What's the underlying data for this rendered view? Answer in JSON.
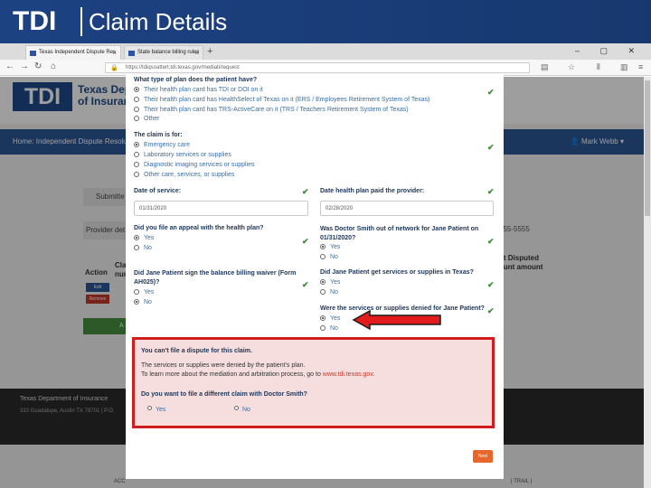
{
  "slide": {
    "logo": "TDI",
    "title": "Claim Details"
  },
  "browser": {
    "tabs": [
      {
        "label": "Texas Independent Dispute Res",
        "close": "×"
      },
      {
        "label": "State balance billing rules",
        "close": "×"
      }
    ],
    "new_tab": "+",
    "window_controls": "– ▢ ✕",
    "url": "https://tdiqsoattert.tdi.texas.gov/mediati/request"
  },
  "background_page": {
    "logo_mark": "TDI",
    "logo_text_1": "Texas Dep",
    "logo_text_2": "of Insuran",
    "nav_left": "Home: Independent Dispute Resolu",
    "nav_right": "Mark Webb ▾",
    "submitted": "Submitte",
    "provider": "Provider det",
    "phone": "555-5555",
    "col_action": "Action",
    "col_claim": "Cla nun",
    "col_right": "nt Disputed ount amount",
    "edit": "Edit",
    "remove": "Remove",
    "green_btn": "A",
    "footer_title": "Texas Department of Insurance",
    "footer_address": "333 Guadalupe, Austin TX 78701 | P.O.",
    "footer_links": "| TRAIL |",
    "footer_acc": "ACC"
  },
  "form": {
    "q_plan_type": "What type of plan does the patient have?",
    "plan_options": [
      "Their health plan card has TDI or DOI on it",
      "Their health plan card has HealthSelect of Texas on it (ERS / Employees Retirement System of Texas)",
      "Their health plan card has TRS-ActiveCare on it (TRS / Teachers Retirement System of Texas)",
      "Other"
    ],
    "q_claim_for": "The claim is for:",
    "claim_options": [
      "Emergency care",
      "Laboratory services or supplies",
      "Diagnostic imaging services or supplies",
      "Other care, services, or supplies"
    ],
    "date_of_service_label": "Date of service:",
    "date_of_service_value": "01/31/2020",
    "date_paid_label": "Date health plan paid the provider:",
    "date_paid_value": "02/28/2020",
    "q_appeal": "Did you file an appeal with the health plan?",
    "q_out_of_network": "Was Doctor Smith out of network for Jane Patient on 01/31/2020?",
    "q_waiver": "Did Jane Patient sign the balance billing waiver (Form AH025)?",
    "q_get_services": "Did Jane Patient get services or supplies in Texas?",
    "q_denied": "Were the services or supplies denied for Jane Patient?",
    "yes": "Yes",
    "no": "No",
    "alert": {
      "title": "You can't file a dispute for this claim.",
      "line1": "The services or supplies were denied by the patient's plan.",
      "line2_prefix": "To learn more about the mediation and arbitration process, go to",
      "link": "www.tdi.texas.gov",
      "line2_suffix": ".",
      "question": "Do you want to file a different claim with Doctor Smith?",
      "yes": "Yes",
      "no": "No"
    },
    "submit": "Next"
  },
  "colors": {
    "slide_blue": "#1d4282",
    "alert_border": "#d11d1d",
    "alert_bg": "#f6dede",
    "check_green": "#3a8a3a",
    "submit_orange": "#e8662b",
    "link_blue": "#3a6ea5"
  },
  "icons": [
    "check-icon",
    "lock-icon",
    "red-arrow-icon",
    "user-icon"
  ]
}
